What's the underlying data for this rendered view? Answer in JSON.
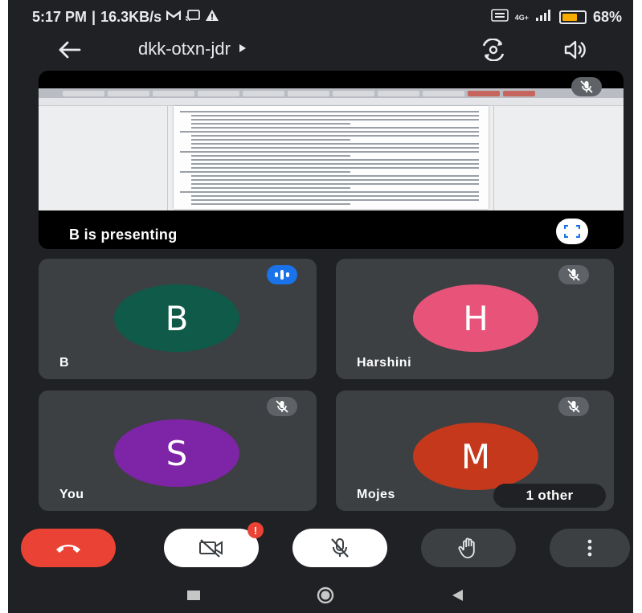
{
  "status_bar": {
    "time": "5:17 PM",
    "separator": "|",
    "speed": "16.3KB/s",
    "network_type": "4G+",
    "battery_percent": "68%",
    "battery_level": 0.68,
    "icons": [
      "gmail-m-icon",
      "cast-icon",
      "warning-icon",
      "volte-icon",
      "signal-icon",
      "battery-icon"
    ]
  },
  "top_bar": {
    "meeting_code": "dkk-otxn-jdr",
    "icons": [
      "back-arrow-icon",
      "play-caret-icon",
      "switch-camera-icon",
      "speaker-icon"
    ]
  },
  "presentation": {
    "label": "B is presenting",
    "icons": [
      "mic-off-icon",
      "fullscreen-icon"
    ]
  },
  "participants": [
    {
      "name": "B",
      "initial": "B",
      "color": "#0f5a49",
      "status": "speaking"
    },
    {
      "name": "Harshini",
      "initial": "H",
      "color": "#e8537a",
      "status": "muted"
    },
    {
      "name": "You",
      "initial": "S",
      "color": "#7e24a6",
      "status": "muted"
    },
    {
      "name": "Mojes",
      "initial": "M",
      "color": "#c5381c",
      "status": "muted",
      "extra": "1 other"
    }
  ],
  "controls": {
    "items": [
      "end-call",
      "camera-off",
      "mic-off",
      "raise-hand",
      "more-options"
    ],
    "camera_alert": "!"
  },
  "navigation": {
    "items": [
      "recent-apps",
      "home",
      "back"
    ]
  },
  "colors": {
    "background": "#202124",
    "tile": "#3c4043",
    "end_call": "#ea4335",
    "speaking": "#1a73e8",
    "badge": "#5f6368"
  }
}
